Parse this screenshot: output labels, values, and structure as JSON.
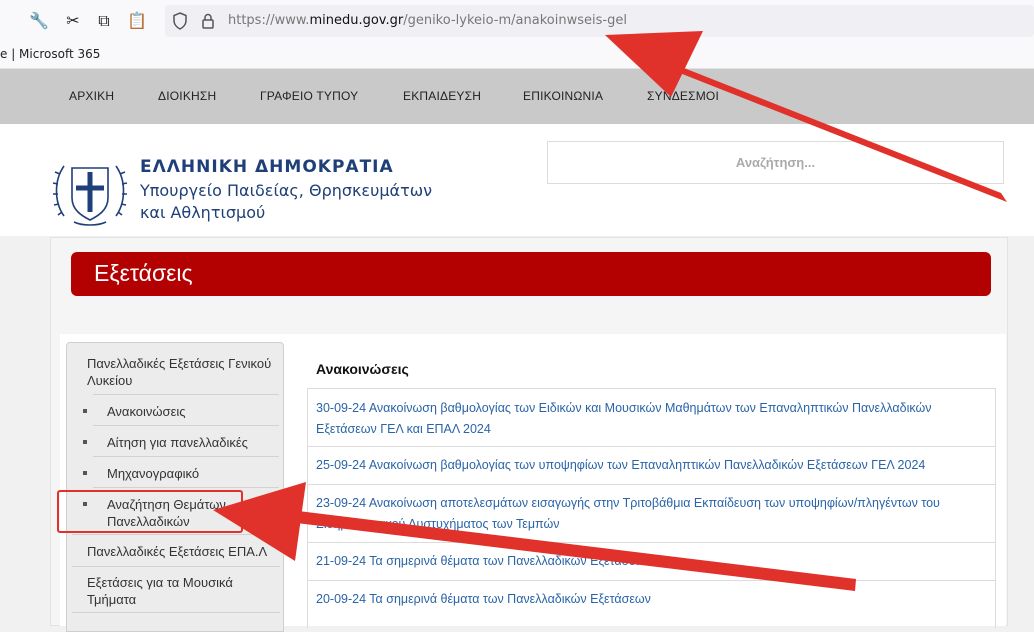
{
  "browser": {
    "url_prefix": "https://www.",
    "url_domain": "minedu.gov.gr",
    "url_path": "/geniko-lykeio-m/anakoinwseis-gel",
    "bookmark": "e | Microsoft 365",
    "icons": [
      "wrench-icon",
      "scissors-icon",
      "copy-icon",
      "paste-icon",
      "shield-icon",
      "lock-icon"
    ]
  },
  "nav": {
    "items": [
      "ΑΡΧΙΚΗ",
      "ΔΙΟΙΚΗΣΗ",
      "ΓΡΑΦΕΙΟ ΤΥΠΟΥ",
      "ΕΚΠΑΙΔΕΥΣΗ",
      "ΕΠΙΚΟΙΝΩΝΙΑ",
      "ΣΥΝΔΕΣΜΟΙ"
    ]
  },
  "header": {
    "logo_line1": "ΕΛΛΗΝΙΚΗ ΔΗΜΟΚΡΑΤΙΑ",
    "logo_line2": "Υπουργείο Παιδείας, Θρησκευμάτων",
    "logo_line3": "και Αθλητισμού",
    "search_placeholder": "Αναζήτηση..."
  },
  "page": {
    "title": "Εξετάσεις"
  },
  "sidebar": {
    "main1": "Πανελλαδικές Εξετάσεις Γενικού Λυκείου",
    "sub1": "Ανακοινώσεις",
    "sub2": "Αίτηση για πανελλαδικές",
    "sub3": "Μηχανογραφικό",
    "sub4": "Αναζήτηση Θεμάτων Πανελλαδικών",
    "main2": "Πανελλαδικές Εξετάσεις ΕΠΑ.Λ",
    "main3": "Εξετάσεις για τα Μουσικά Τμήματα"
  },
  "announcements": {
    "heading": "Ανακοινώσεις",
    "items": [
      "30-09-24 Ανακοίνωση βαθμολογίας των Ειδικών και Μουσικών Μαθημάτων των Επαναληπτικών Πανελλαδικών Εξετάσεων ΓΕΛ και ΕΠΑΛ 2024",
      "25-09-24 Ανακοίνωση βαθμολογίας των υποψηφίων των Επαναληπτικών Πανελλαδικών Εξετάσεων ΓΕΛ 2024",
      "23-09-24 Ανακοίνωση αποτελεσμάτων εισαγωγής στην Τριτοβάθμια Εκπαίδευση των υποψηφίων/πληγέντων του Σιδηροδρομικού Δυστυχήματος των Τεμπών",
      "21-09-24 Τα σημερινά θέματα των Πανελλαδικών Εξετάσεων",
      "20-09-24 Τα σημερινά θέματα των Πανελλαδικών Εξετάσεων"
    ]
  },
  "annotation": {
    "arrow_color": "#e0312a"
  }
}
